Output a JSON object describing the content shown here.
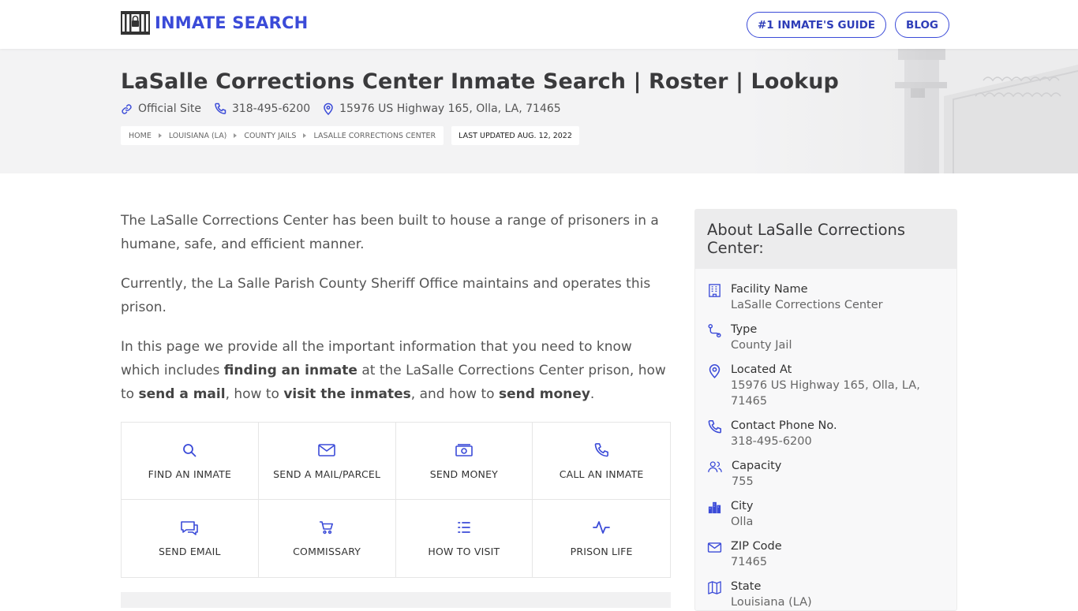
{
  "brand": {
    "name": "INMATE SEARCH"
  },
  "nav": {
    "guide": "#1 INMATE'S GUIDE",
    "blog": "BLOG"
  },
  "hero": {
    "title": "LaSalle Corrections Center Inmate Search | Roster | Lookup",
    "official_site": "Official Site",
    "phone": "318-495-6200",
    "address": "15976 US Highway 165, Olla, LA, 71465",
    "breadcrumbs": [
      "HOME",
      "LOUISIANA (LA)",
      "COUNTY JAILS",
      "LASALLE CORRECTIONS CENTER"
    ],
    "last_updated": "LAST UPDATED AUG. 12, 2022"
  },
  "main": {
    "p1": "The LaSalle Corrections Center has been built to house a range of prisoners in a humane, safe, and efficient manner.",
    "p2": "Currently, the La Salle Parish County Sheriff Office maintains and operates this prison.",
    "p3": {
      "t1": "In this page we provide all the important information that you need to know which includes ",
      "b1": "finding an inmate",
      "t2": " at the LaSalle Corrections Center prison, how to ",
      "b2": "send a mail",
      "t3": ", how to ",
      "b3": "visit the inmates",
      "t4": ", and how to ",
      "b4": "send money",
      "t5": "."
    },
    "actions": [
      {
        "label": "FIND AN INMATE",
        "icon": "search-icon"
      },
      {
        "label": "SEND A MAIL/PARCEL",
        "icon": "envelope-icon"
      },
      {
        "label": "SEND MONEY",
        "icon": "money-icon"
      },
      {
        "label": "CALL AN INMATE",
        "icon": "phone-icon"
      },
      {
        "label": "SEND EMAIL",
        "icon": "chat-icon"
      },
      {
        "label": "COMMISSARY",
        "icon": "cart-icon"
      },
      {
        "label": "HOW TO VISIT",
        "icon": "list-icon"
      },
      {
        "label": "PRISON LIFE",
        "icon": "pulse-icon"
      }
    ]
  },
  "sidebar": {
    "title": "About LaSalle Corrections Center:",
    "items": [
      {
        "label": "Facility Name",
        "value": "LaSalle Corrections Center",
        "icon": "building-icon"
      },
      {
        "label": "Type",
        "value": "County Jail",
        "icon": "route-icon"
      },
      {
        "label": "Located At",
        "value": "15976 US Highway 165, Olla, LA, 71465",
        "icon": "location-pin-icon"
      },
      {
        "label": "Contact Phone No.",
        "value": "318-495-6200",
        "icon": "phone-icon"
      },
      {
        "label": "Capacity",
        "value": "755",
        "icon": "users-icon"
      },
      {
        "label": "City",
        "value": "Olla",
        "icon": "city-icon"
      },
      {
        "label": "ZIP Code",
        "value": "71465",
        "icon": "envelope-icon"
      },
      {
        "label": "State",
        "value": "Louisiana (LA)",
        "icon": "map-icon"
      }
    ]
  },
  "colors": {
    "accent": "#3b4bd8",
    "hero_bg": "#f3f3f4",
    "text": "#555555"
  }
}
